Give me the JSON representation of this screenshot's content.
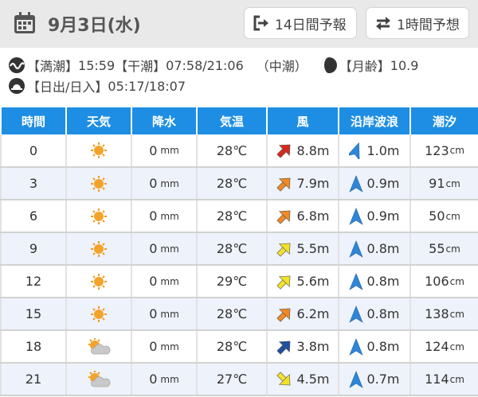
{
  "header": {
    "date": "9月3日(水)",
    "btn_14day": "14日間予報",
    "btn_1hour": "1時間予想"
  },
  "info": {
    "high_tide_label": "【満潮】",
    "high_tide_value": "15:59",
    "low_tide_label": "【干潮】",
    "low_tide_value": "07:58/21:06",
    "tide_type": "（中潮）",
    "moon_label": "【月齢】",
    "moon_value": "10.9",
    "sun_label": "【日出/日入】",
    "sun_value": "05:17/18:07"
  },
  "columns": [
    "時間",
    "天気",
    "降水",
    "気温",
    "風",
    "沿岸波浪",
    "潮汐"
  ],
  "units": {
    "precip": "mm",
    "tide": "cm"
  },
  "colors": {
    "header_bg": "#e9e9e9",
    "table_header": "#1d8ee3",
    "row_alt": "#eef2fa"
  },
  "rows": [
    {
      "time": "0",
      "weather": "sunny-icon",
      "precip": "0",
      "temp": "28℃",
      "wind": "8.8m",
      "wind_color": "#d72a1e",
      "wind_rot": 45,
      "wave": "1.0m",
      "wave_rot": 20,
      "tide": "123"
    },
    {
      "time": "3",
      "weather": "sunny-icon",
      "precip": "0",
      "temp": "28℃",
      "wind": "7.9m",
      "wind_color": "#f08a24",
      "wind_rot": 45,
      "wave": "0.9m",
      "wave_rot": 0,
      "tide": "91"
    },
    {
      "time": "6",
      "weather": "sunny-icon",
      "precip": "0",
      "temp": "28℃",
      "wind": "6.8m",
      "wind_color": "#f08a24",
      "wind_rot": 45,
      "wave": "0.9m",
      "wave_rot": 0,
      "tide": "50"
    },
    {
      "time": "9",
      "weather": "sunny-icon",
      "precip": "0",
      "temp": "28℃",
      "wind": "5.5m",
      "wind_color": "#f2e12c",
      "wind_rot": 45,
      "wave": "0.8m",
      "wave_rot": 0,
      "tide": "55"
    },
    {
      "time": "12",
      "weather": "sunny-icon",
      "precip": "0",
      "temp": "29℃",
      "wind": "5.6m",
      "wind_color": "#f2e12c",
      "wind_rot": 45,
      "wave": "0.8m",
      "wave_rot": 0,
      "tide": "106"
    },
    {
      "time": "15",
      "weather": "sunny-icon",
      "precip": "0",
      "temp": "28℃",
      "wind": "6.2m",
      "wind_color": "#f08a24",
      "wind_rot": 45,
      "wave": "0.8m",
      "wave_rot": 0,
      "tide": "138"
    },
    {
      "time": "18",
      "weather": "sunny-cloudy-icon",
      "precip": "0",
      "temp": "28℃",
      "wind": "3.8m",
      "wind_color": "#1f4fa0",
      "wind_rot": 45,
      "wave": "0.8m",
      "wave_rot": 0,
      "tide": "124"
    },
    {
      "time": "21",
      "weather": "sunny-cloudy-icon",
      "precip": "0",
      "temp": "27℃",
      "wind": "4.5m",
      "wind_color": "#f2e12c",
      "wind_rot": 135,
      "wave": "0.7m",
      "wave_rot": 0,
      "tide": "114"
    }
  ]
}
